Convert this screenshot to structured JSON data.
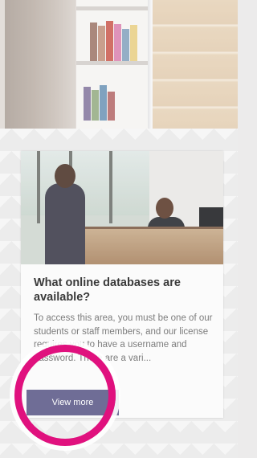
{
  "card": {
    "title": "What online databases are available?",
    "description": "To access this area, you must be one of our students or staff members, and our license requires you to have a username and password. There are a vari...",
    "button_label": "View more"
  },
  "colors": {
    "button_bg": "#6f6d96",
    "highlight_ring": "#e0117e",
    "title_text": "#3a3a3a",
    "body_text": "#7c7c7c"
  },
  "images": {
    "top_photo": "library-shelves-photo",
    "card_photo": "reception-desk-photo"
  }
}
